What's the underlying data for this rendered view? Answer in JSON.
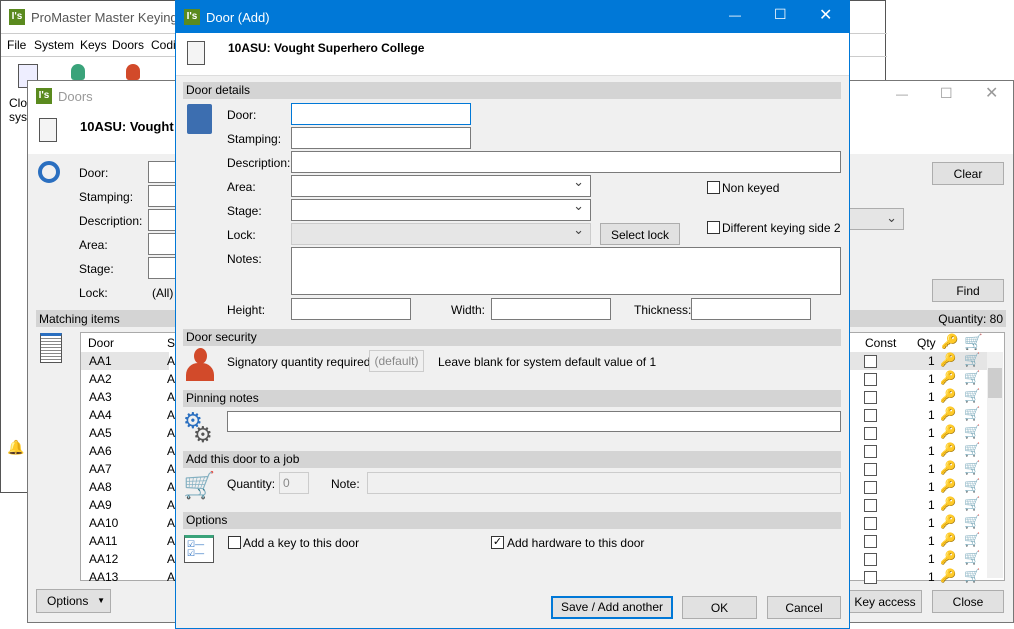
{
  "main_window": {
    "title": "ProMaster Master Keying 8",
    "menu": [
      "File",
      "System",
      "Keys",
      "Doors",
      "Codi"
    ],
    "toolbar_label": "Clo syst"
  },
  "doors_window": {
    "title": "Doors",
    "system": "10ASU: Vought S",
    "filters": [
      "Door:",
      "Stamping:",
      "Description:",
      "Area:",
      "Stage:",
      "Lock:"
    ],
    "lock_value": "(All)",
    "clear": "Clear",
    "find": "Find",
    "matching_items": "Matching items",
    "quantity": "Quantity: 80",
    "columns": {
      "door": "Door",
      "s": "S",
      "const": "Const",
      "qty": "Qty"
    },
    "rows": [
      "AA1",
      "AA2",
      "AA3",
      "AA4",
      "AA5",
      "AA6",
      "AA7",
      "AA8",
      "AA9",
      "AA10",
      "AA11",
      "AA12",
      "AA13"
    ],
    "row_s": "A",
    "row_qty": "1",
    "options": "Options",
    "key_access": "Key access",
    "close": "Close"
  },
  "dialog": {
    "title": "Door (Add)",
    "system": "10ASU: Vought Superhero College",
    "door_details": "Door details",
    "door": "Door:",
    "stamping": "Stamping:",
    "description": "Description:",
    "area": "Area:",
    "stage": "Stage:",
    "lock": "Lock:",
    "select_lock": "Select lock",
    "notes": "Notes:",
    "non_keyed": "Non keyed",
    "diff_keying": "Different keying side 2",
    "height": "Height:",
    "width": "Width:",
    "thickness": "Thickness:",
    "door_security": "Door security",
    "signatory": "Signatory quantity required:",
    "signatory_value": "(default)",
    "signatory_hint": "Leave blank for system default value of 1",
    "pinning_notes": "Pinning notes",
    "add_job": "Add this door to a job",
    "quantity": "Quantity:",
    "quantity_value": "0",
    "note": "Note:",
    "options": "Options",
    "add_key": "Add a key to this door",
    "add_key_checked": false,
    "add_hardware": "Add hardware to this door",
    "add_hardware_checked": true,
    "save_add": "Save / Add another",
    "ok": "OK",
    "cancel": "Cancel"
  },
  "colors": {
    "titlebar": "#0078d7",
    "logo": "#5a8a1e",
    "key": "#e8a83c",
    "cart": "#2a6fc0"
  }
}
